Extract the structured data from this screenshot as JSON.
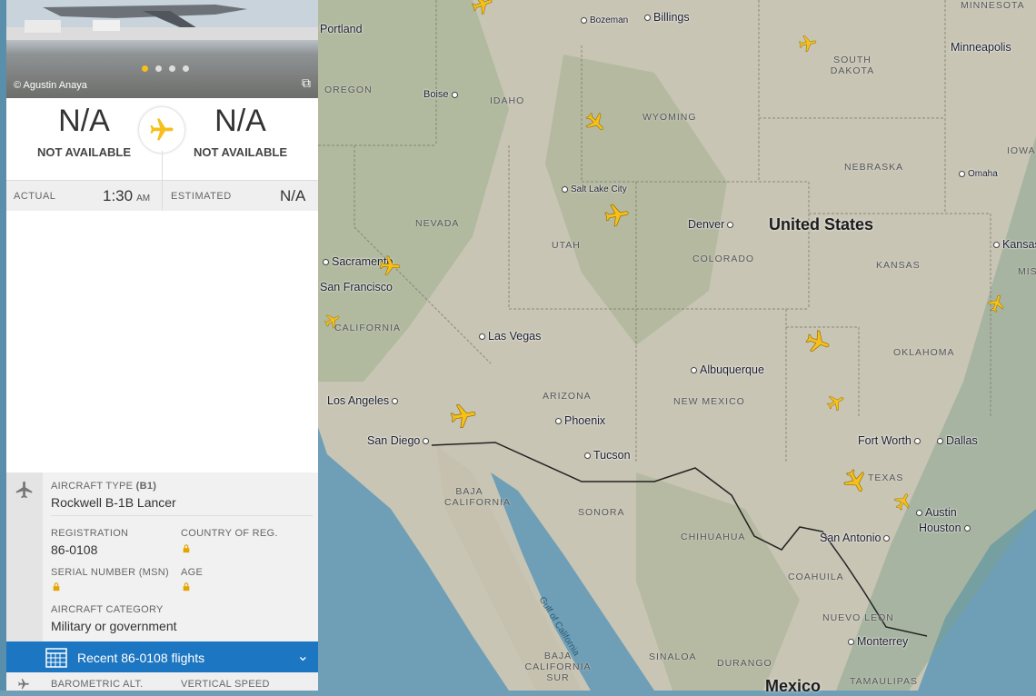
{
  "photo": {
    "credit": "© Agustin Anaya",
    "slides": 4,
    "active_slide": 1
  },
  "route": {
    "origin_code": "N/A",
    "origin_name": "NOT AVAILABLE",
    "dest_code": "N/A",
    "dest_name": "NOT AVAILABLE"
  },
  "times": {
    "actual_label": "ACTUAL",
    "actual_value": "1:30",
    "actual_suffix": "AM",
    "estimated_label": "ESTIMATED",
    "estimated_value": "N/A"
  },
  "aircraft": {
    "type_label": "AIRCRAFT TYPE",
    "type_code": "(B1)",
    "type_value": "Rockwell B-1B Lancer",
    "registration_label": "REGISTRATION",
    "registration_value": "86-0108",
    "country_label": "COUNTRY OF REG.",
    "serial_label": "SERIAL NUMBER (MSN)",
    "age_label": "AGE",
    "category_label": "AIRCRAFT CATEGORY",
    "category_value": "Military or government"
  },
  "recent": {
    "label": "Recent 86-0108 flights"
  },
  "baro": {
    "alt_label": "BAROMETRIC ALT.",
    "vs_label": "VERTICAL SPEED"
  },
  "map": {
    "country_us": "United States",
    "country_mx": "Mexico",
    "cities": [
      "Billings",
      "Bozeman",
      "Boise",
      "Salt Lake City",
      "Denver",
      "Sacramento",
      "San Francisco",
      "Las Vegas",
      "Los Angeles",
      "San Diego",
      "Phoenix",
      "Tucson",
      "Albuquerque",
      "Fort Worth",
      "Dallas",
      "Austin",
      "Houston",
      "San Antonio",
      "Monterrey",
      "Minneapolis",
      "Omaha",
      "Kansas",
      "Portland"
    ],
    "states": [
      "SOUTH DAKOTA",
      "OREGON",
      "IDAHO",
      "WYOMING",
      "NEBRASKA",
      "IOWA",
      "NEVADA",
      "UTAH",
      "COLORADO",
      "KANSAS",
      "CALIFORNIA",
      "OKLAHOMA",
      "ARIZONA",
      "NEW MEXICO",
      "TEXAS",
      "BAJA CALIFORNIA",
      "SONORA",
      "CHIHUAHUA",
      "COAHUILA",
      "NUEVO LEON",
      "BAJA CALIFORNIA SUR",
      "SINALOA",
      "DURANGO",
      "TAMAULIPAS",
      "MINNESOTA",
      "MIS"
    ],
    "water": "Gulf of California",
    "accent": "#f6bf1a"
  }
}
